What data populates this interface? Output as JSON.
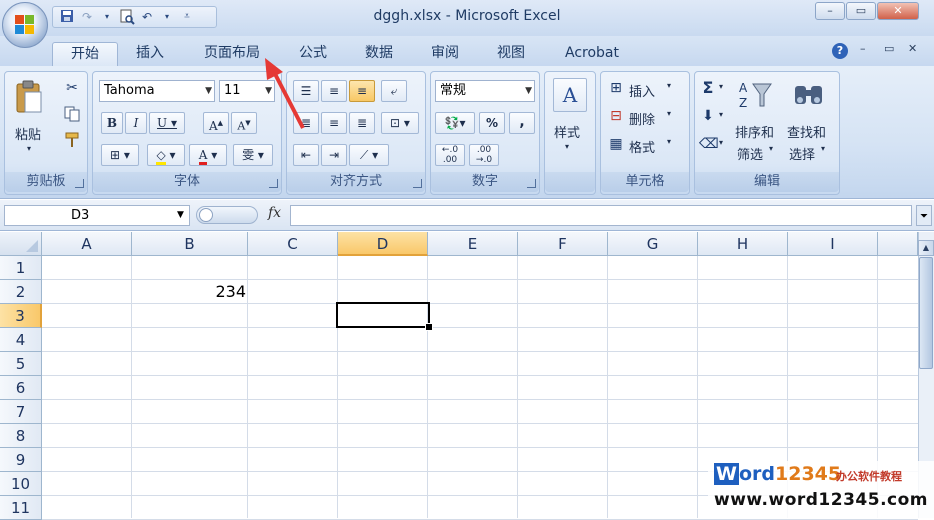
{
  "window": {
    "title": "dggh.xlsx - Microsoft Excel",
    "minimize": "–",
    "restore": "▭",
    "close": "✕"
  },
  "tabs": [
    "开始",
    "插入",
    "页面布局",
    "公式",
    "数据",
    "审阅",
    "视图",
    "Acrobat"
  ],
  "ribbon": {
    "clipboard": {
      "label": "剪贴板",
      "paste": "粘贴"
    },
    "font": {
      "label": "字体",
      "font_name": "Tahoma",
      "font_size": "11"
    },
    "alignment": {
      "label": "对齐方式"
    },
    "number": {
      "label": "数字",
      "format": "常规",
      "percent": "%",
      "comma": ","
    },
    "styles": {
      "label": "样式"
    },
    "cells": {
      "label": "单元格",
      "insert": "插入",
      "delete": "删除",
      "format": "格式"
    },
    "editing": {
      "label": "编辑",
      "sort_filter": [
        "排序和",
        "筛选"
      ],
      "find_select": [
        "查找和",
        "选择"
      ]
    }
  },
  "formula_bar": {
    "name_box": "D3",
    "fx": "fx",
    "formula": ""
  },
  "sheet": {
    "columns": [
      "A",
      "B",
      "C",
      "D",
      "E",
      "F",
      "G",
      "H",
      "I"
    ],
    "rows": [
      "1",
      "2",
      "3",
      "4",
      "5",
      "6",
      "7",
      "8",
      "9",
      "10",
      "11"
    ],
    "selected_column": "D",
    "selected_row": "3",
    "cells": {
      "B2": "234"
    }
  },
  "watermark": {
    "logo_w": "W",
    "logo_ord": "ord",
    "logo_num": "12345",
    "sub": "办公软件教程",
    "url": "www.word12345.com"
  },
  "colors": {
    "accent": "#f9c86a",
    "title": "#1f3b64",
    "arrow": "#e53935"
  }
}
